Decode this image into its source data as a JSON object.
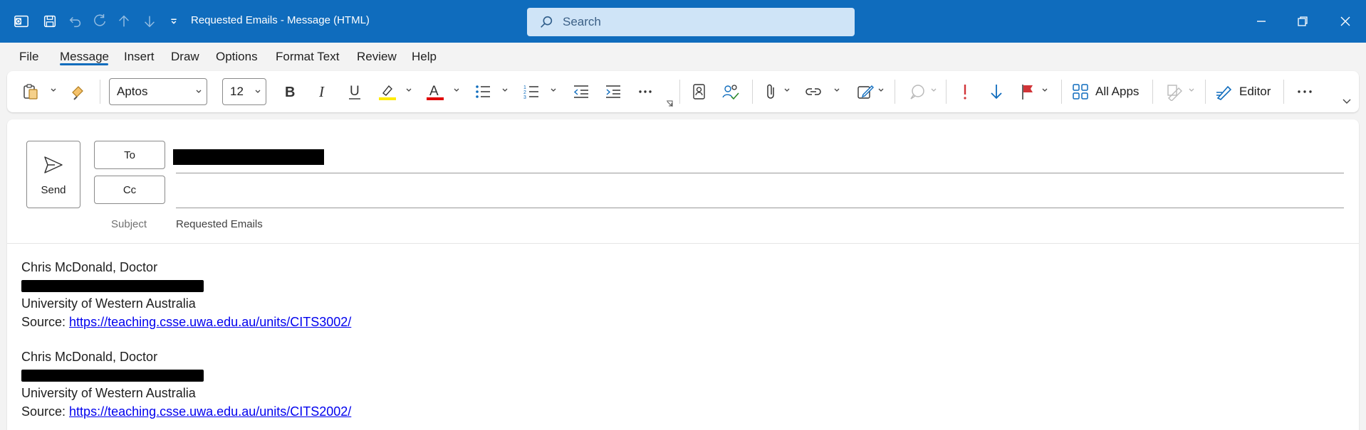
{
  "window": {
    "title": "Requested Emails  -  Message (HTML)",
    "search_placeholder": "Search"
  },
  "menu": {
    "items": [
      "File",
      "Message",
      "Insert",
      "Draw",
      "Options",
      "Format Text",
      "Review",
      "Help"
    ],
    "active": "Message"
  },
  "ribbon": {
    "font_name": "Aptos",
    "font_size": "12",
    "all_apps_label": "All Apps",
    "editor_label": "Editor",
    "highlight_color": "#ffeb00",
    "font_color": "#e00000"
  },
  "compose": {
    "send_label": "Send",
    "to_label": "To",
    "cc_label": "Cc",
    "subject_label": "Subject",
    "subject_value": "Requested Emails"
  },
  "message_body": {
    "entries": [
      {
        "name": "Chris McDonald, Doctor",
        "organization": "University of Western Australia",
        "source_label": "Source: ",
        "source_url": "https://teaching.csse.uwa.edu.au/units/CITS3002/"
      },
      {
        "name": "Chris McDonald, Doctor",
        "organization": "University of Western Australia",
        "source_label": "Source: ",
        "source_url": "https://teaching.csse.uwa.edu.au/units/CITS2002/"
      }
    ]
  }
}
